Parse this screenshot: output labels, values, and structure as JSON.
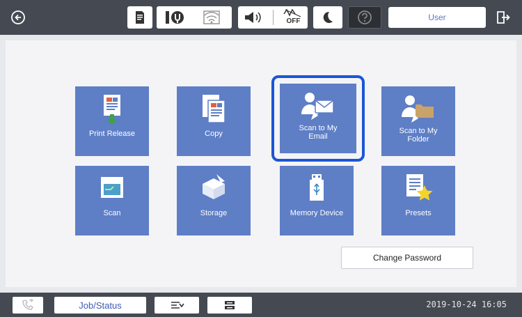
{
  "colors": {
    "bar": "#454a52",
    "tile": "#5e7ec6",
    "selection": "#1a56d6",
    "accent_text": "#3b5bb5"
  },
  "topbar": {
    "icons": [
      "back-icon",
      "paper-status-icon",
      "network-status-icon",
      "wifi-icon",
      "volume-icon",
      "power-save-off-icon",
      "sleep-icon",
      "help-icon",
      "logout-icon"
    ],
    "power_save_label": "OFF",
    "user_label": "User"
  },
  "tiles": [
    {
      "label": "Print Release",
      "icon": "print-release-icon"
    },
    {
      "label": "Copy",
      "icon": "copy-icon"
    },
    {
      "label": "Scan to My Email",
      "label_lines": [
        "Scan to My",
        "Email"
      ],
      "icon": "scan-email-icon",
      "selected": true
    },
    {
      "label": "Scan to My Folder",
      "label_lines": [
        "Scan to My",
        "Folder"
      ],
      "icon": "scan-folder-icon"
    },
    {
      "label": "Scan",
      "icon": "scan-icon"
    },
    {
      "label": "Storage",
      "icon": "storage-icon"
    },
    {
      "label": "Memory Device",
      "icon": "memory-device-icon"
    },
    {
      "label": "Presets",
      "icon": "presets-icon"
    }
  ],
  "change_password_label": "Change Password",
  "bottombar": {
    "job_status_label": "Job/Status",
    "icons": [
      "fax-icon",
      "stop-icon",
      "tray-icon"
    ],
    "datetime": "2019-10-24 16:05"
  }
}
